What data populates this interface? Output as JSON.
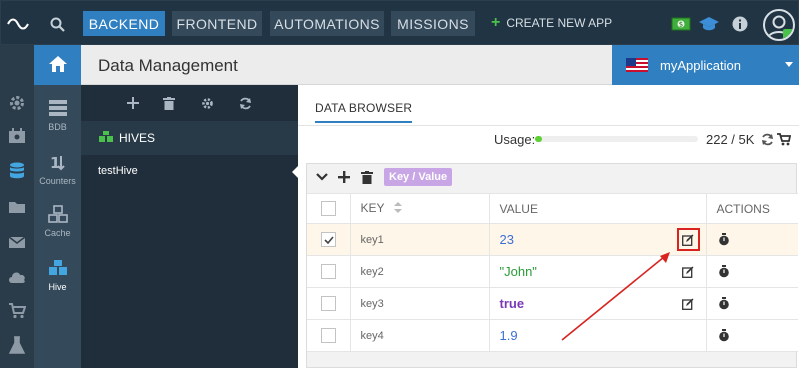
{
  "topbar": {
    "tabs": [
      {
        "label": "BACKEND",
        "active": true
      },
      {
        "label": "FRONTEND",
        "active": false
      },
      {
        "label": "AUTOMATIONS",
        "active": false
      },
      {
        "label": "MISSIONS",
        "active": false
      }
    ],
    "create_app_label": "CREATE NEW APP"
  },
  "subnav": {
    "items": [
      {
        "label": "BDB"
      },
      {
        "label": "Counters"
      },
      {
        "label": "Cache"
      },
      {
        "label": "Hive"
      }
    ]
  },
  "header": {
    "title": "Data Management"
  },
  "app_selector": {
    "name": "myApplication"
  },
  "hives": {
    "title": "HIVES",
    "items": [
      {
        "name": "testHive"
      }
    ]
  },
  "main": {
    "tab_label": "DATA BROWSER",
    "usage": {
      "label": "Usage:",
      "value": "222 / 5K",
      "fraction": 0.044
    },
    "tag_label": "Key / Value",
    "columns": {
      "key": "KEY",
      "value": "VALUE",
      "actions": "ACTIONS"
    },
    "rows": [
      {
        "key": "key1",
        "value": "23",
        "type": "num",
        "checked": true
      },
      {
        "key": "key2",
        "value": "\"John\"",
        "type": "str",
        "checked": false
      },
      {
        "key": "key3",
        "value": "true",
        "type": "bool",
        "checked": false
      },
      {
        "key": "key4",
        "value": "1.9",
        "type": "num",
        "checked": false
      }
    ]
  },
  "colors": {
    "accent": "#2f7fc1",
    "topbar_bg": "#203443",
    "highlight": "#d9231f",
    "usage_fill": "#5cd132"
  }
}
